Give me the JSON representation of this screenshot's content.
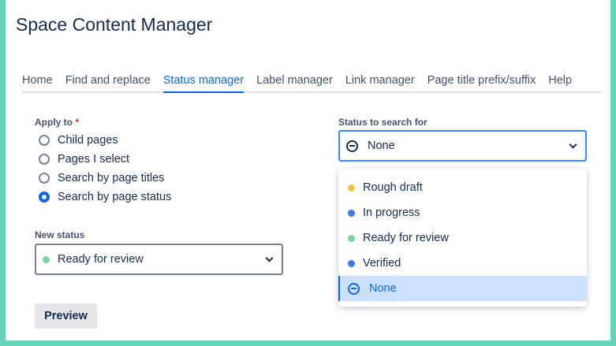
{
  "title": "Space Content Manager",
  "tabs": [
    {
      "label": "Home"
    },
    {
      "label": "Find and replace"
    },
    {
      "label": "Status manager"
    },
    {
      "label": "Label manager"
    },
    {
      "label": "Link manager"
    },
    {
      "label": "Page title prefix/suffix"
    },
    {
      "label": "Help"
    }
  ],
  "apply_to": {
    "label": "Apply to",
    "required": "*",
    "options": [
      "Child pages",
      "Pages I select",
      "Search by page titles",
      "Search by page status"
    ],
    "selected": "Search by page status"
  },
  "new_status": {
    "label": "New status",
    "value": "Ready for review",
    "color": "#7ed3a4"
  },
  "search_status": {
    "label": "Status to search for",
    "value": "None"
  },
  "dropdown": [
    {
      "label": "Rough draft",
      "color": "#f5c342"
    },
    {
      "label": "In progress",
      "color": "#3d7cf0"
    },
    {
      "label": "Ready for review",
      "color": "#7ed3a4"
    },
    {
      "label": "Verified",
      "color": "#3d7cf0"
    },
    {
      "label": "None",
      "selected": true
    }
  ],
  "preview_label": "Preview"
}
